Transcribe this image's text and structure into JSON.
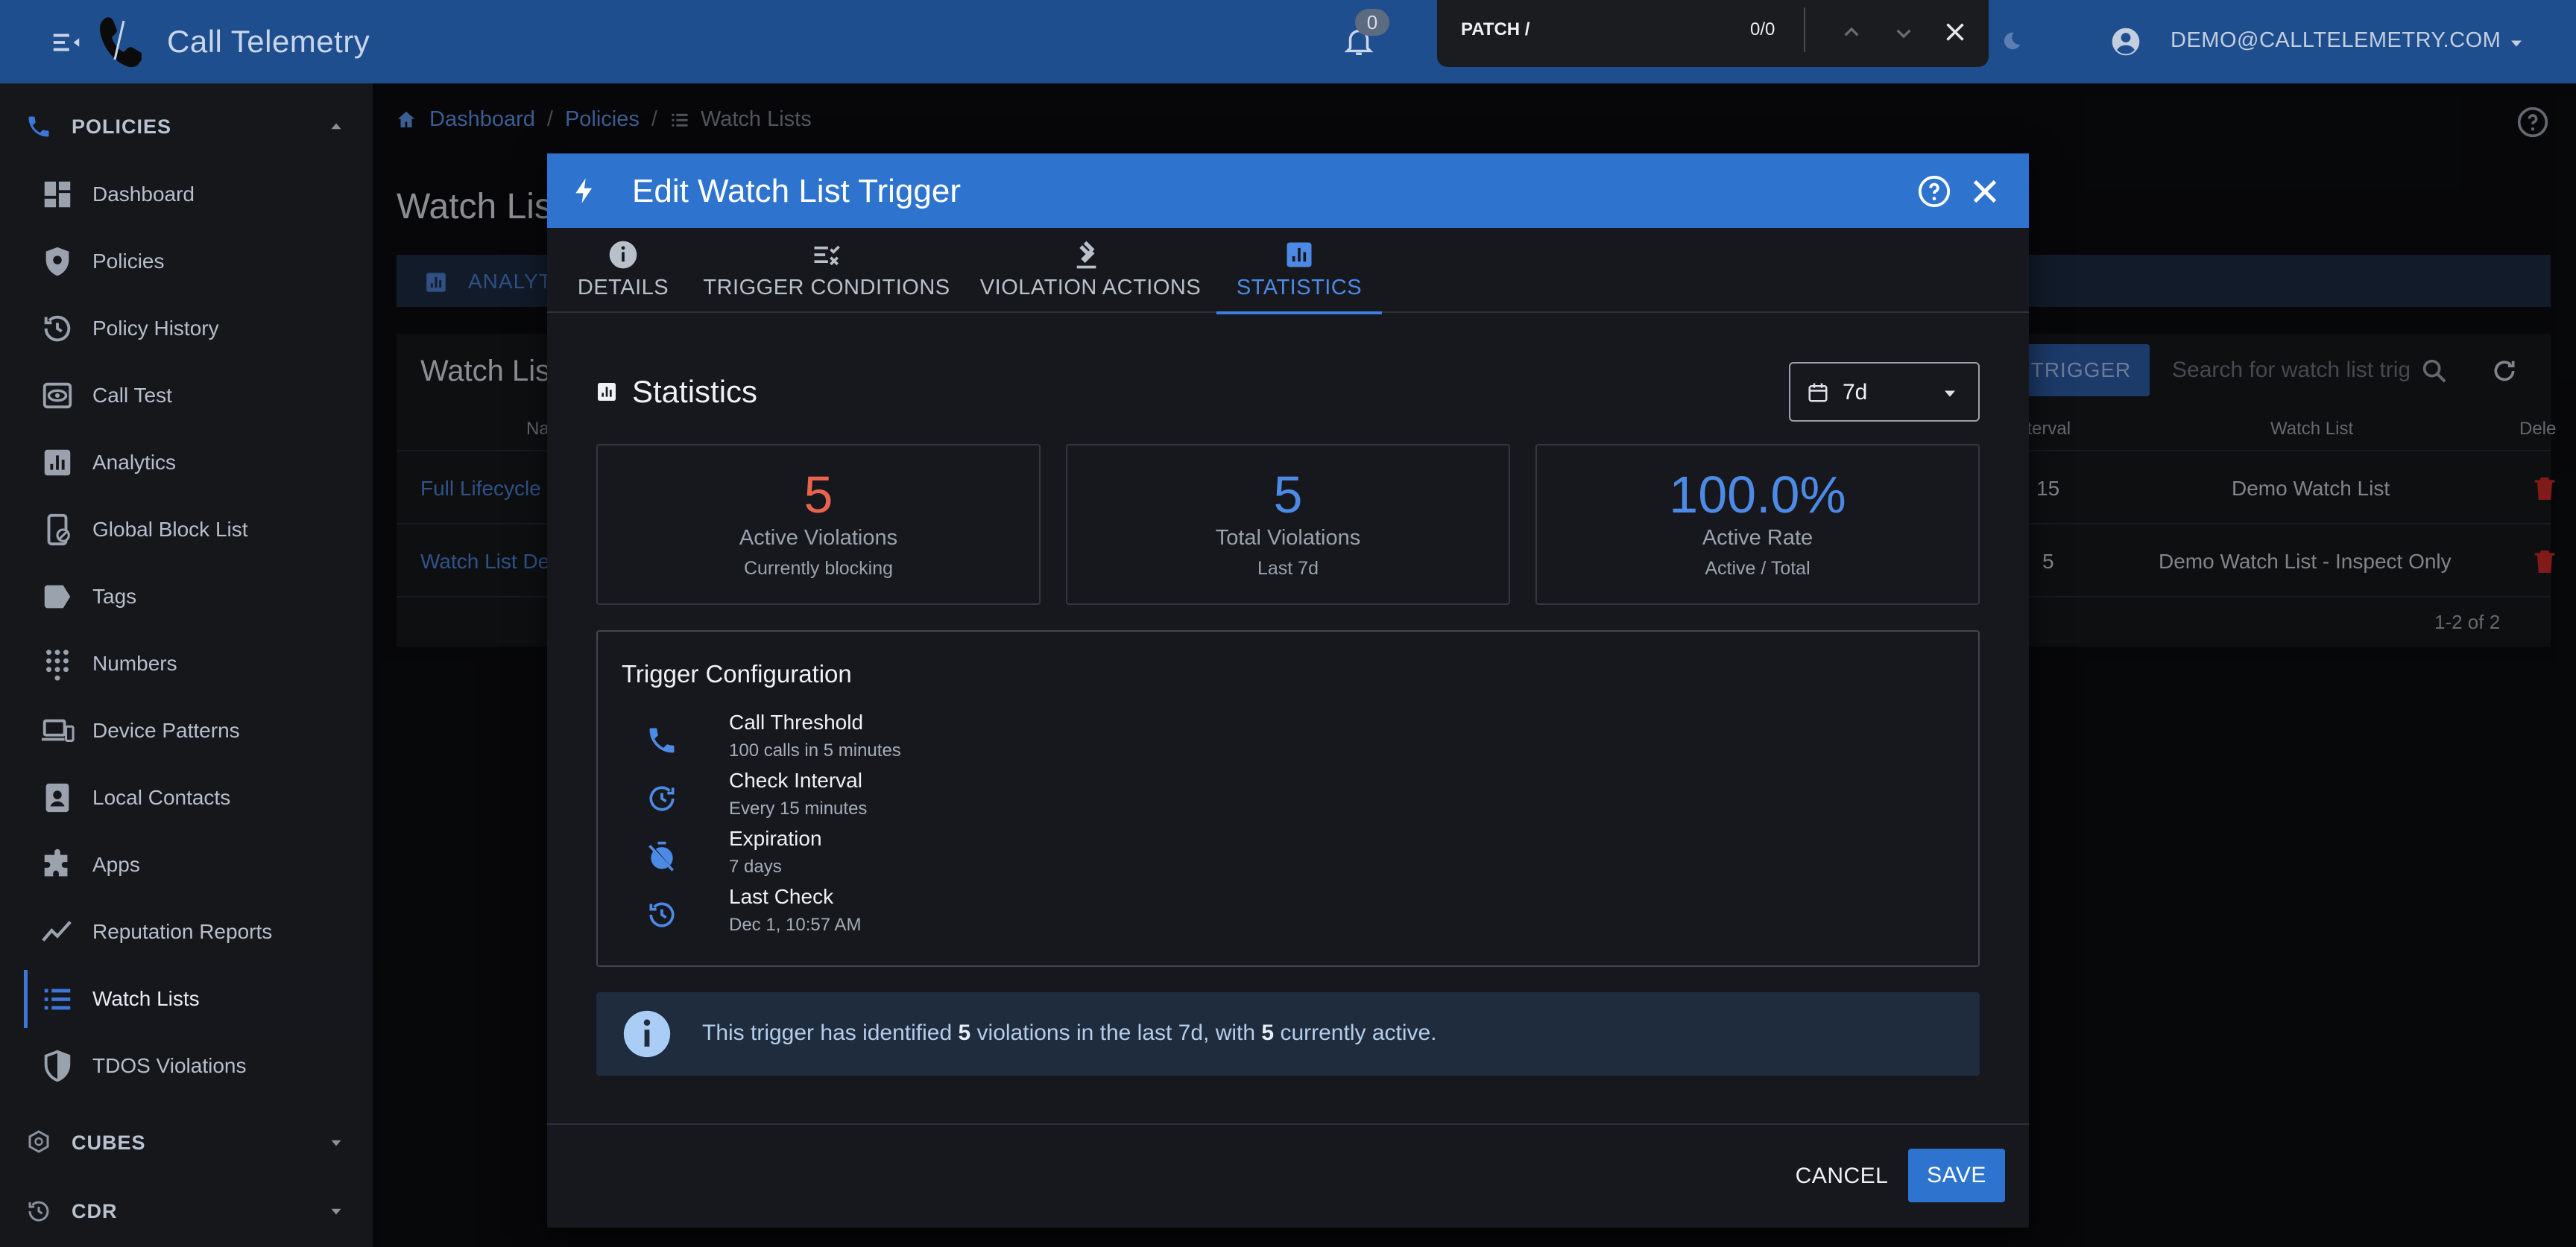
{
  "app": {
    "title": "Call Telemetry",
    "notifications_count": "0",
    "user_email": "DEMO@CALLTELEMETRY.COM"
  },
  "find_bar": {
    "query": "PATCH /",
    "count": "0/0"
  },
  "sidebar": {
    "groups": [
      {
        "label": "POLICIES",
        "icon": "phone-settings-icon",
        "expanded": true
      },
      {
        "label": "CUBES",
        "icon": "cube-settings-icon",
        "expanded": false
      },
      {
        "label": "CDR",
        "icon": "history-icon",
        "expanded": false
      }
    ],
    "items": [
      {
        "label": "Dashboard",
        "icon": "dashboard-icon"
      },
      {
        "label": "Policies",
        "icon": "shield-gear-icon"
      },
      {
        "label": "Policy History",
        "icon": "history-icon"
      },
      {
        "label": "Call Test",
        "icon": "eye-box-icon"
      },
      {
        "label": "Analytics",
        "icon": "analytics-icon"
      },
      {
        "label": "Global Block List",
        "icon": "phone-block-icon"
      },
      {
        "label": "Tags",
        "icon": "tag-icon"
      },
      {
        "label": "Numbers",
        "icon": "dialpad-icon"
      },
      {
        "label": "Device Patterns",
        "icon": "devices-icon"
      },
      {
        "label": "Local Contacts",
        "icon": "contact-card-icon"
      },
      {
        "label": "Apps",
        "icon": "puzzle-icon"
      },
      {
        "label": "Reputation Reports",
        "icon": "trend-icon"
      },
      {
        "label": "Watch Lists",
        "icon": "list-icon",
        "active": true
      },
      {
        "label": "TDOS Violations",
        "icon": "shield-half-icon"
      }
    ]
  },
  "breadcrumb": {
    "items": [
      "Dashboard",
      "Policies",
      "Watch Lists"
    ]
  },
  "background": {
    "page_title": "Watch Lis",
    "tab_label": "ANALYT",
    "card_title": "Watch Lis",
    "trigger_button": "TRIGGER",
    "search_placeholder": "Search for watch list trig",
    "columns": {
      "name": "Na",
      "interval": "nterval",
      "watch_list": "Watch List",
      "delete": "Dele"
    },
    "rows": [
      {
        "name": "Full Lifecycle T",
        "interval": "15",
        "watch_list": "Demo Watch List"
      },
      {
        "name": "Watch List De",
        "interval": "5",
        "watch_list": "Demo Watch List - Inspect Only"
      }
    ],
    "pagination": "1-2 of 2"
  },
  "dialog": {
    "title": "Edit Watch List Trigger",
    "tabs": [
      {
        "label": "DETAILS",
        "icon": "info-icon"
      },
      {
        "label": "TRIGGER CONDITIONS",
        "icon": "checklist-icon"
      },
      {
        "label": "VIOLATION ACTIONS",
        "icon": "gavel-icon"
      },
      {
        "label": "STATISTICS",
        "icon": "chart-box-icon",
        "active": true
      }
    ],
    "statistics": {
      "heading": "Statistics",
      "range": "7d",
      "cards": [
        {
          "value": "5",
          "label": "Active Violations",
          "sub": "Currently blocking",
          "color": "#e9634f"
        },
        {
          "value": "5",
          "label": "Total Violations",
          "sub": "Last 7d",
          "color": "#4d8ae6"
        },
        {
          "value": "100.0%",
          "label": "Active Rate",
          "sub": "Active / Total",
          "color": "#4d8ae6"
        }
      ],
      "config": {
        "title": "Trigger Configuration",
        "rows": [
          {
            "title": "Call Threshold",
            "sub": "100 calls in 5 minutes",
            "icon": "phone-icon"
          },
          {
            "title": "Check Interval",
            "sub": "Every 15 minutes",
            "icon": "refresh-clock-icon"
          },
          {
            "title": "Expiration",
            "sub": "7 days",
            "icon": "timer-off-icon"
          },
          {
            "title": "Last Check",
            "sub": "Dec 1, 10:57 AM",
            "icon": "history-icon"
          }
        ]
      },
      "alert": {
        "prefix": "This trigger has identified ",
        "total": "5",
        "middle": " violations in the last 7d, with ",
        "active": "5",
        "suffix": " currently active."
      }
    },
    "cancel_label": "CANCEL",
    "save_label": "SAVE"
  },
  "colors": {
    "app_bar": "#1f4e8f",
    "dialog_header": "#2e74cf",
    "accent": "#4d8ae6",
    "danger": "#e9634f",
    "delete": "#c62828"
  }
}
